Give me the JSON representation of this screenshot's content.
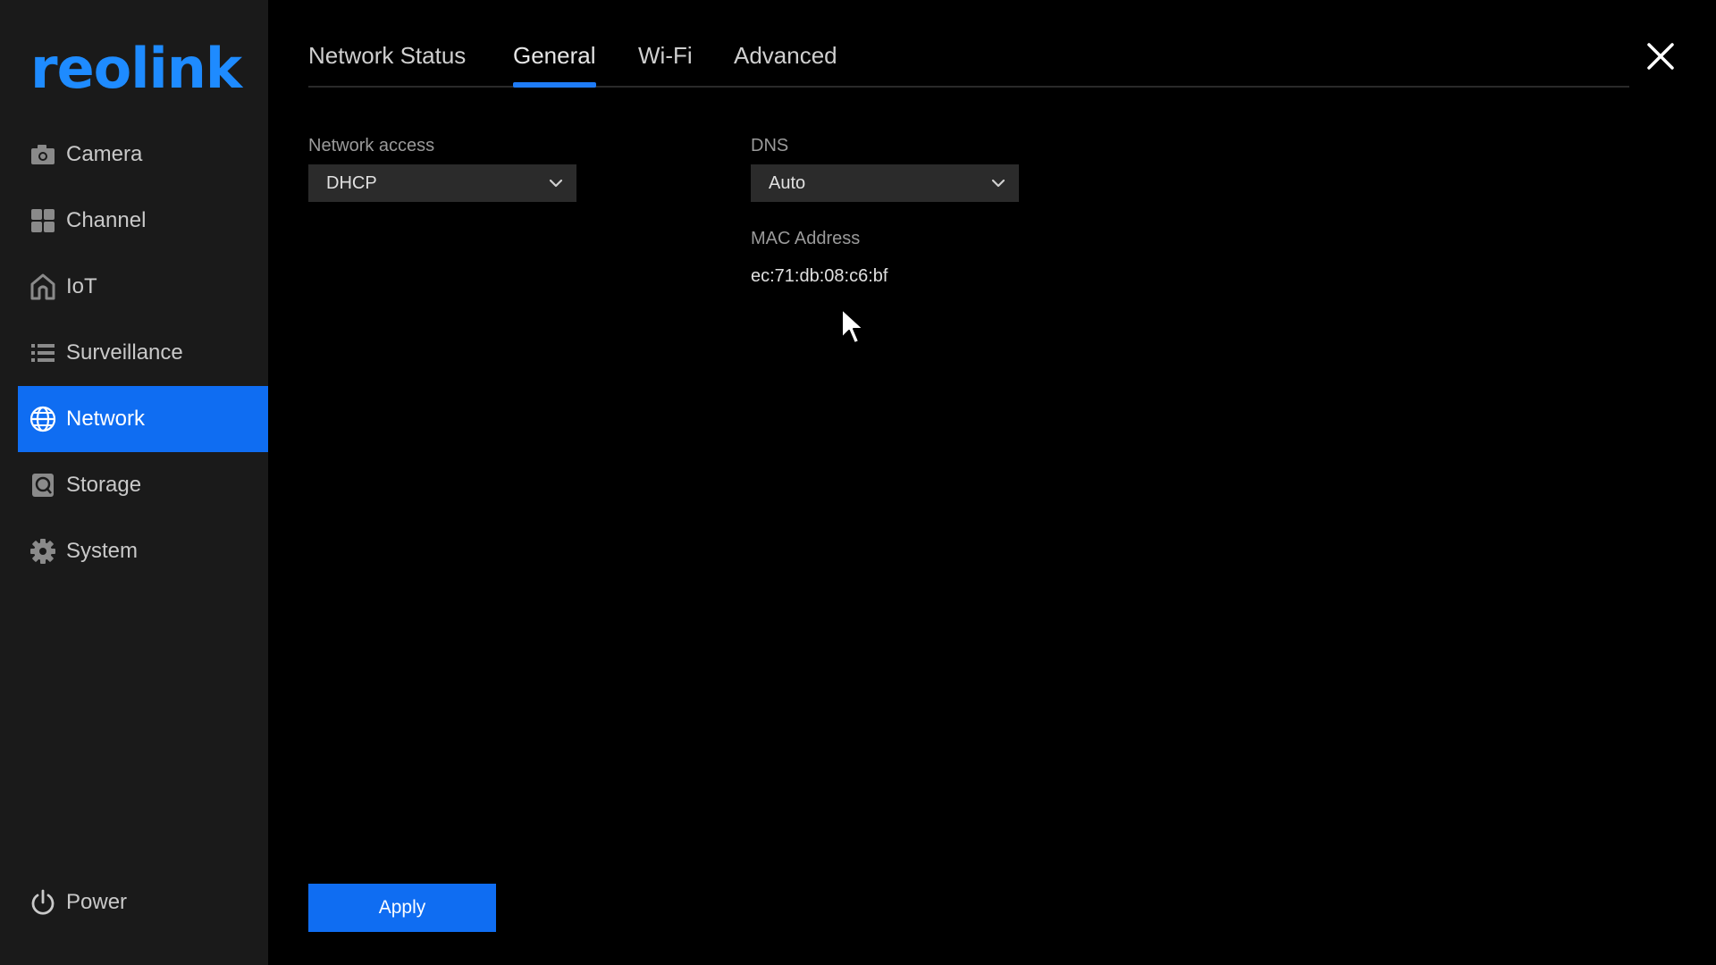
{
  "brand": {
    "logo_text": "reolink",
    "logo_color": "#1e8bff"
  },
  "sidebar": {
    "items": [
      {
        "label": "Camera",
        "icon": "camera-icon",
        "active": false
      },
      {
        "label": "Channel",
        "icon": "grid-icon",
        "active": false
      },
      {
        "label": "IoT",
        "icon": "home-icon",
        "active": false
      },
      {
        "label": "Surveillance",
        "icon": "list-icon",
        "active": false
      },
      {
        "label": "Network",
        "icon": "globe-icon",
        "active": true
      },
      {
        "label": "Storage",
        "icon": "storage-icon",
        "active": false
      },
      {
        "label": "System",
        "icon": "gear-icon",
        "active": false
      }
    ],
    "power_label": "Power"
  },
  "tabs": [
    {
      "label": "Network Status",
      "active": false
    },
    {
      "label": "General",
      "active": true
    },
    {
      "label": "Wi-Fi",
      "active": false
    },
    {
      "label": "Advanced",
      "active": false
    }
  ],
  "form": {
    "network_access": {
      "label": "Network access",
      "value": "DHCP"
    },
    "dns": {
      "label": "DNS",
      "value": "Auto"
    },
    "mac": {
      "label": "MAC Address",
      "value": "ec:71:db:08:c6:bf"
    }
  },
  "actions": {
    "apply_label": "Apply"
  },
  "colors": {
    "accent": "#0f6df2",
    "sidebar_bg": "#1a1a1a",
    "background": "#000000",
    "field_bg": "#2b2b2b"
  }
}
